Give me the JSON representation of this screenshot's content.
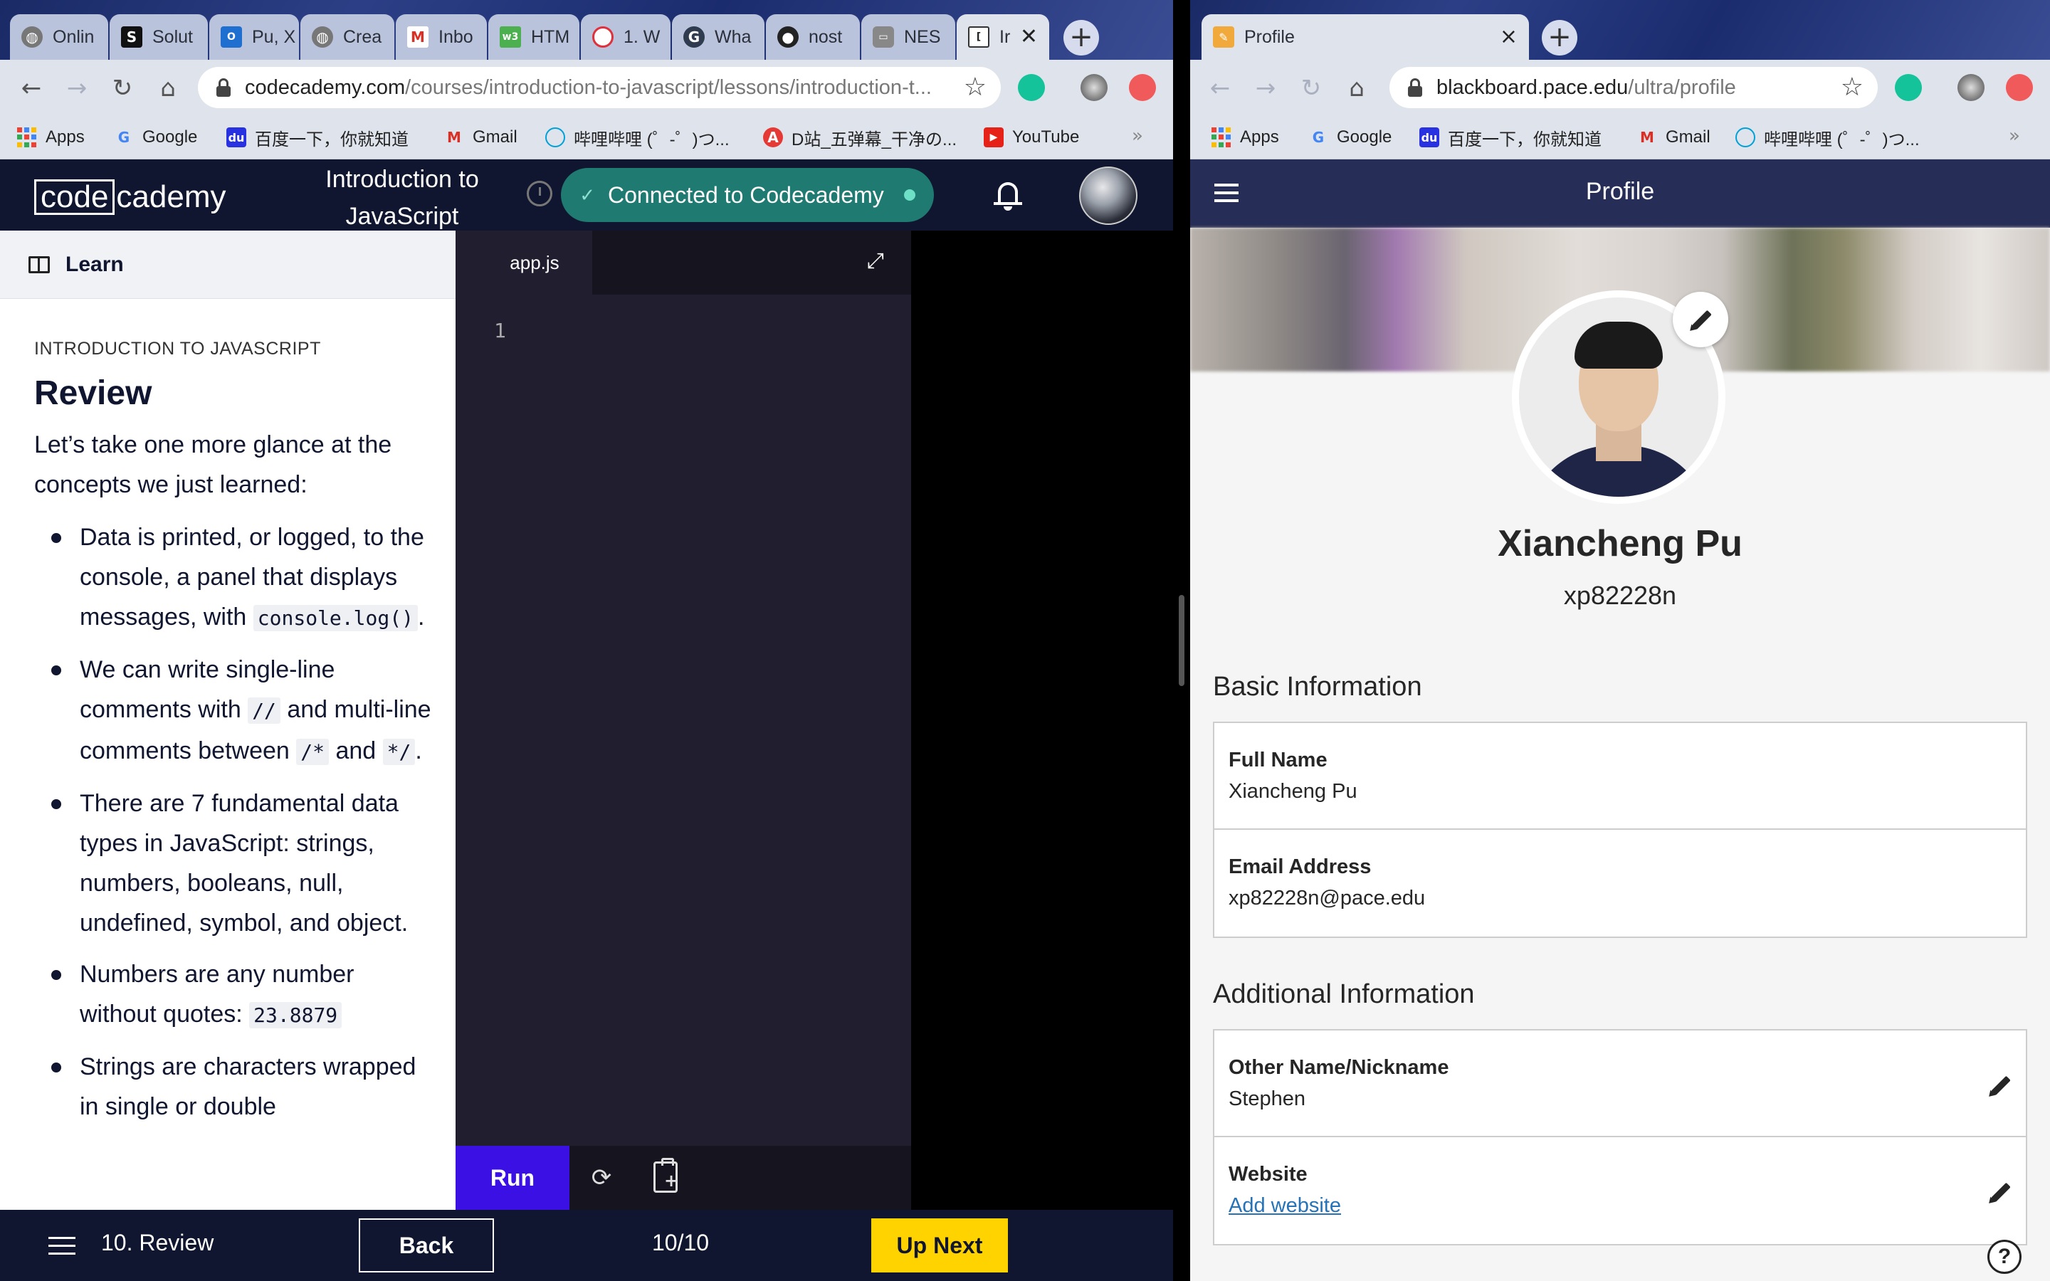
{
  "left_browser": {
    "tabs": [
      {
        "label": "Onlin",
        "icon": "globe-icon"
      },
      {
        "label": "Solut",
        "icon": "s-logo-icon"
      },
      {
        "label": "Pu, X",
        "icon": "outlook-icon"
      },
      {
        "label": "Crea",
        "icon": "globe-icon"
      },
      {
        "label": "Inbo",
        "icon": "gmail-icon"
      },
      {
        "label": "HTM",
        "icon": "w3-icon"
      },
      {
        "label": "1. W",
        "icon": "opera-icon"
      },
      {
        "label": "Wha",
        "icon": "grammarly-icon"
      },
      {
        "label": "nost",
        "icon": "github-icon"
      },
      {
        "label": "NES",
        "icon": "controller-icon"
      },
      {
        "label": "Ir",
        "icon": "codecademy-icon",
        "active": true
      }
    ],
    "url_host": "codecademy.com",
    "url_path": "/courses/introduction-to-javascript/lessons/introduction-t...",
    "bookmarks": [
      {
        "label": "Apps"
      },
      {
        "label": "Google"
      },
      {
        "label": "百度一下，你就知道"
      },
      {
        "label": "Gmail"
      },
      {
        "label": "哔哩哔哩 (゜-゜)つ..."
      },
      {
        "label": "D站_五弹幕_干净の..."
      },
      {
        "label": "YouTube"
      }
    ],
    "bookmarks_more": "»"
  },
  "codecademy": {
    "logo_box": "code",
    "logo_rest": "cademy",
    "course_title": "Introduction to JavaScript",
    "connected_label": "Connected to Codecademy",
    "learn_tab_label": "Learn",
    "kicker": "INTRODUCTION TO JAVASCRIPT",
    "title": "Review",
    "intro": "Let’s take one more glance at the concepts we just learned:",
    "bullets": {
      "b1_text": "Data is printed, or logged, to the console, a panel that displays messages, with",
      "b1_code": "console.log()",
      "b1_end": ".",
      "b2_text": "We can write single-line comments with",
      "b2_code1": "//",
      "b2_mid": "and multi-line comments between",
      "b2_code2": "/*",
      "b2_and": "and",
      "b2_code3": "*/",
      "b2_end": ".",
      "b3_text": "There are 7 fundamental data types in JavaScript: strings, numbers, booleans, null, undefined, symbol, and object.",
      "b4_text": "Numbers are any number without quotes:",
      "b4_code": "23.8879",
      "b5_text": "Strings are characters wrapped in single or double"
    },
    "editor": {
      "file_tab": "app.js",
      "line_number": "1",
      "run_label": "Run"
    },
    "footer": {
      "lesson_label": "10. Review",
      "back_label": "Back",
      "progress": "10/10",
      "up_next_label": "Up Next"
    },
    "colors": {
      "header_bg": "#10162f",
      "connected_bg": "#1f7a72",
      "run_bg": "#3a10e5",
      "up_next_bg": "#ffd300"
    }
  },
  "right_browser": {
    "tab_label": "Profile",
    "tab_close": "×",
    "url_host": "blackboard.pace.edu",
    "url_path": "/ultra/profile",
    "bookmarks": [
      {
        "label": "Apps"
      },
      {
        "label": "Google"
      },
      {
        "label": "百度一下，你就知道"
      },
      {
        "label": "Gmail"
      },
      {
        "label": "哔哩哔哩 (゜-゜)つ..."
      }
    ],
    "bookmarks_more": "»"
  },
  "profile": {
    "header_title": "Profile",
    "name": "Xiancheng Pu",
    "username": "xp82228n",
    "basic_section_title": "Basic Information",
    "full_name_label": "Full Name",
    "full_name_value": "Xiancheng Pu",
    "email_label": "Email Address",
    "email_value": "xp82228n@pace.edu",
    "additional_section_title": "Additional Information",
    "nickname_label": "Other Name/Nickname",
    "nickname_value": "Stephen",
    "website_label": "Website",
    "website_value": "Add website",
    "help_label": "?",
    "colors": {
      "header_bg": "#262d56",
      "link": "#2672b8"
    }
  }
}
